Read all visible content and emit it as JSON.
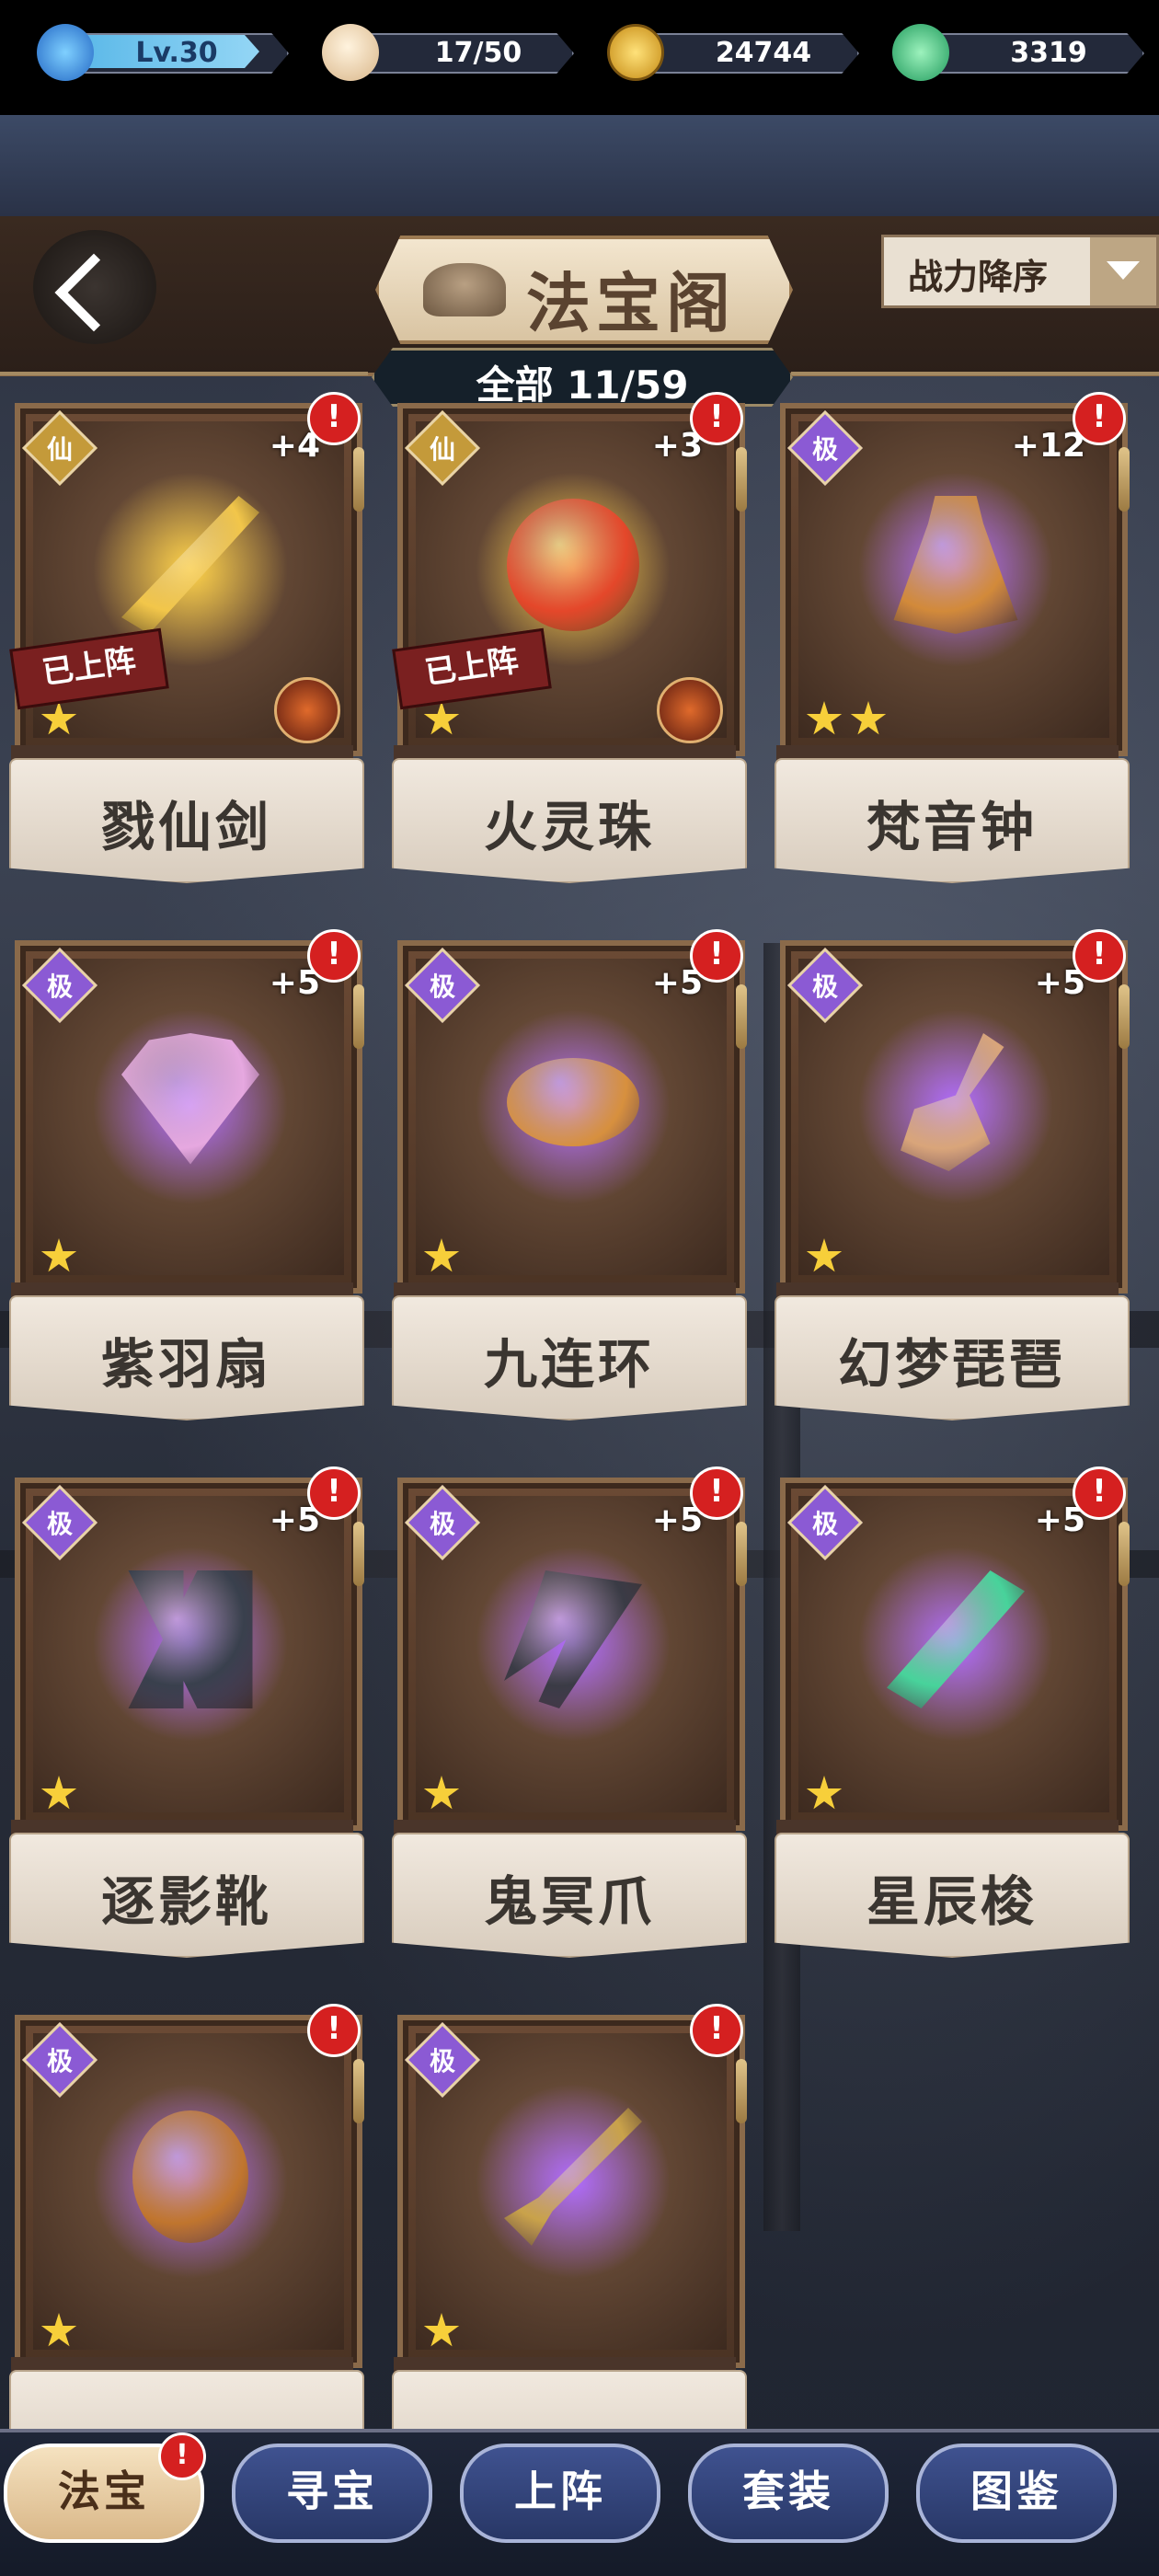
{
  "resources": {
    "level": "Lv.30",
    "stamina": "17/50",
    "coins": "24744",
    "jade": "3319"
  },
  "header": {
    "title": "法宝阁",
    "sort_label": "战力降序",
    "count_label": "全部 11/59"
  },
  "items": [
    {
      "name": "戮仙剑",
      "tier": "仙",
      "plus": "+4",
      "alert": "!",
      "stars": 1,
      "deployed_label": "已上阵",
      "deployed": true,
      "color": "#f2c64a"
    },
    {
      "name": "火灵珠",
      "tier": "仙",
      "plus": "+3",
      "alert": "!",
      "stars": 1,
      "deployed_label": "已上阵",
      "deployed": true,
      "color": "#e4472a"
    },
    {
      "name": "梵音钟",
      "tier": "极",
      "plus": "+12",
      "alert": "!",
      "stars": 2,
      "deployed_label": "",
      "deployed": false,
      "color": "#d28a3a"
    },
    {
      "name": "紫羽扇",
      "tier": "极",
      "plus": "+5",
      "alert": "!",
      "stars": 1,
      "deployed_label": "",
      "deployed": false,
      "color": "#e6a8e0"
    },
    {
      "name": "九连环",
      "tier": "极",
      "plus": "+5",
      "alert": "!",
      "stars": 1,
      "deployed_label": "",
      "deployed": false,
      "color": "#d7903e"
    },
    {
      "name": "幻梦琵琶",
      "tier": "极",
      "plus": "+5",
      "alert": "!",
      "stars": 1,
      "deployed_label": "",
      "deployed": false,
      "color": "#d9a57a"
    },
    {
      "name": "逐影靴",
      "tier": "极",
      "plus": "+5",
      "alert": "!",
      "stars": 1,
      "deployed_label": "",
      "deployed": false,
      "color": "#39404d"
    },
    {
      "name": "鬼冥爪",
      "tier": "极",
      "plus": "+5",
      "alert": "!",
      "stars": 1,
      "deployed_label": "",
      "deployed": false,
      "color": "#3a3b45"
    },
    {
      "name": "星辰梭",
      "tier": "极",
      "plus": "+5",
      "alert": "!",
      "stars": 1,
      "deployed_label": "",
      "deployed": false,
      "color": "#48d39b"
    },
    {
      "name": "",
      "tier": "极",
      "plus": "",
      "alert": "!",
      "stars": 1,
      "deployed_label": "",
      "deployed": false,
      "color": "#c0752e"
    },
    {
      "name": "",
      "tier": "极",
      "plus": "",
      "alert": "!",
      "stars": 1,
      "deployed_label": "",
      "deployed": false,
      "color": "#c9a24a"
    }
  ],
  "nav": {
    "tabs": [
      "法宝",
      "寻宝",
      "上阵",
      "套装",
      "图鉴"
    ],
    "active": "法宝",
    "alert": "!"
  },
  "colors": {
    "accent_red": "#d52020",
    "glow_purple": "#b06cff",
    "glow_gold": "#ffd34a"
  }
}
